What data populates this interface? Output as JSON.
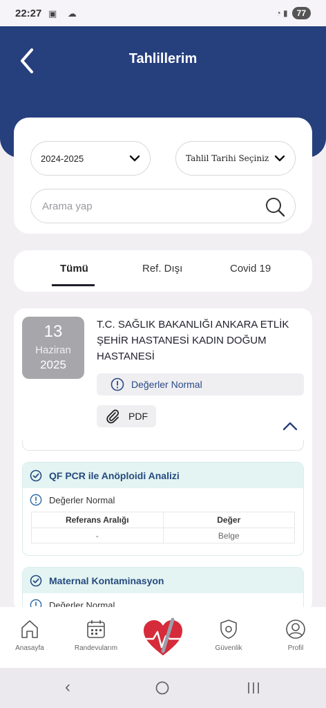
{
  "status_bar": {
    "time": "22:27",
    "battery": "77"
  },
  "header": {
    "title": "Tahlillerim"
  },
  "filters": {
    "year_select": "2024-2025",
    "date_select": "Tahlil Tarihi Seçiniz",
    "search_placeholder": "Arama yap"
  },
  "tabs": [
    {
      "label": "Tümü"
    },
    {
      "label": "Ref. Dışı"
    },
    {
      "label": "Covid 19"
    }
  ],
  "result": {
    "day": "13",
    "month": "Haziran",
    "year": "2025",
    "hospital": "T.C. SAĞLIK BAKANLIĞI ANKARA ETLİK ŞEHİR HASTANESİ KADIN DOĞUM HASTANESİ",
    "status": "Değerler Normal",
    "pdf_label": "PDF"
  },
  "tests": [
    {
      "name": "QF PCR ile Anöploidi Analizi",
      "status": "Değerler Normal",
      "ref_header": "Referans Aralığı",
      "value_header": "Değer",
      "ref_value": "-",
      "value": "Belge"
    },
    {
      "name": "Maternal Kontaminasyon",
      "status": "Değerler Normal"
    }
  ],
  "bottom_nav": [
    {
      "label": "Anasayfa",
      "icon": "home-icon"
    },
    {
      "label": "Randevularım",
      "icon": "calendar-icon"
    },
    {
      "label": "Güvenlik",
      "icon": "shield-gear-icon"
    },
    {
      "label": "Profil",
      "icon": "user-icon"
    }
  ],
  "colors": {
    "primary": "#263f7d",
    "teal": "#e3f4f3",
    "accent_red": "#d62b3a"
  }
}
